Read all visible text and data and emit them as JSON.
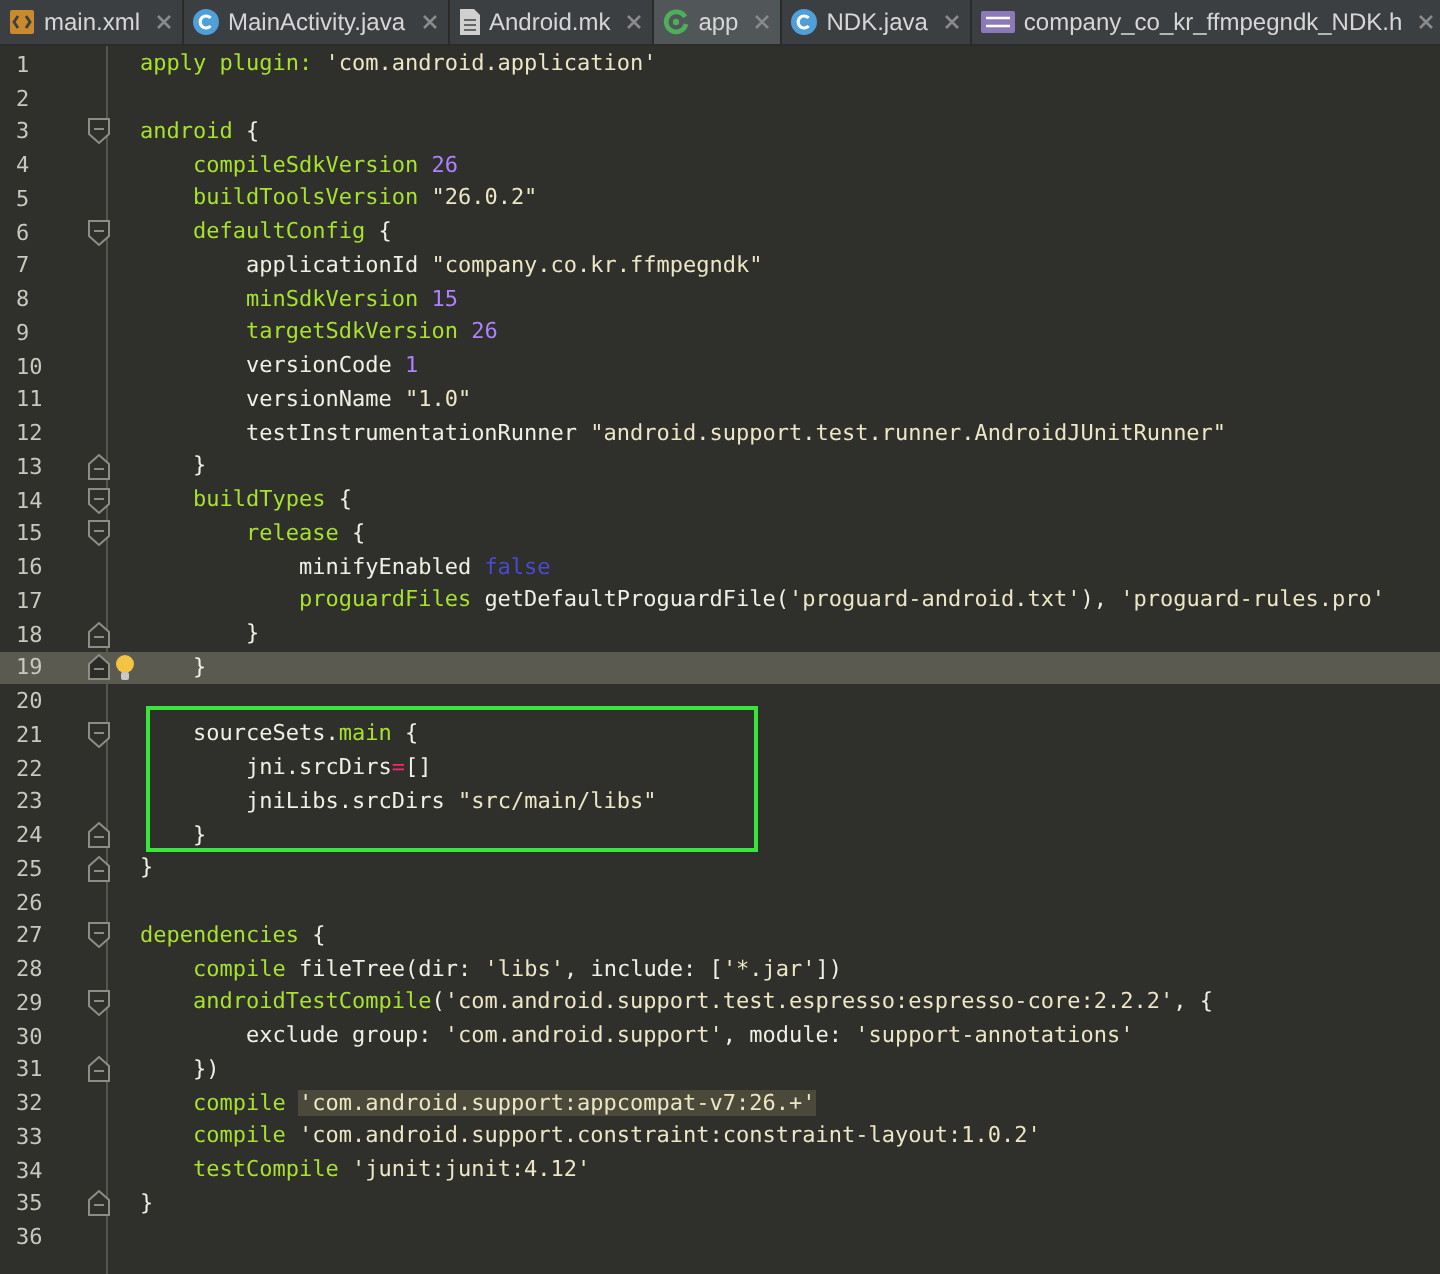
{
  "tabs": [
    {
      "label": "main.xml",
      "kind": "xml",
      "selected": false
    },
    {
      "label": "MainActivity.java",
      "kind": "class",
      "selected": false
    },
    {
      "label": "Android.mk",
      "kind": "text",
      "selected": false
    },
    {
      "label": "app",
      "kind": "gradle",
      "selected": true
    },
    {
      "label": "NDK.java",
      "kind": "class",
      "selected": false
    },
    {
      "label": "company_co_kr_ffmpegndk_NDK.h",
      "kind": "header",
      "selected": false
    }
  ],
  "lines": [
    {
      "n": "1",
      "fold_start": false,
      "fold_end": false,
      "current": false,
      "bulb": false,
      "boxed": false,
      "tokens": [
        {
          "t": "apply plugin: ",
          "kind": "k"
        },
        {
          "t": "'com.android.application'",
          "kind": "s"
        }
      ]
    },
    {
      "n": "2",
      "fold_start": false,
      "fold_end": false,
      "current": false,
      "bulb": false,
      "boxed": false
    },
    {
      "n": "3",
      "fold_start": true,
      "fold_end": false,
      "current": false,
      "bulb": false,
      "boxed": false,
      "tokens": [
        {
          "t": "android",
          "kind": "k"
        },
        {
          "t": " {",
          "kind": "p"
        }
      ]
    },
    {
      "n": "4",
      "fold_start": false,
      "fold_end": false,
      "current": false,
      "bulb": false,
      "boxed": false,
      "tokens": [
        {
          "t": "    compileSdkVersion ",
          "kind": "k"
        },
        {
          "t": "26",
          "kind": "n"
        }
      ]
    },
    {
      "n": "5",
      "fold_start": false,
      "fold_end": false,
      "current": false,
      "bulb": false,
      "boxed": false,
      "tokens": [
        {
          "t": "    buildToolsVersion ",
          "kind": "k"
        },
        {
          "t": "\"26.0.2\"",
          "kind": "s"
        }
      ]
    },
    {
      "n": "6",
      "fold_start": true,
      "fold_end": false,
      "current": false,
      "bulb": false,
      "boxed": false,
      "tokens": [
        {
          "t": "    defaultConfig",
          "kind": "k"
        },
        {
          "t": " {",
          "kind": "p"
        }
      ]
    },
    {
      "n": "7",
      "fold_start": false,
      "fold_end": false,
      "current": false,
      "bulb": false,
      "boxed": false,
      "tokens": [
        {
          "t": "        applicationId ",
          "kind": "p"
        },
        {
          "t": "\"company.co.kr.ffmpegndk\"",
          "kind": "s"
        }
      ]
    },
    {
      "n": "8",
      "fold_start": false,
      "fold_end": false,
      "current": false,
      "bulb": false,
      "boxed": false,
      "tokens": [
        {
          "t": "        minSdkVersion ",
          "kind": "k"
        },
        {
          "t": "15",
          "kind": "n"
        }
      ]
    },
    {
      "n": "9",
      "fold_start": false,
      "fold_end": false,
      "current": false,
      "bulb": false,
      "boxed": false,
      "tokens": [
        {
          "t": "        targetSdkVersion ",
          "kind": "k"
        },
        {
          "t": "26",
          "kind": "n"
        }
      ]
    },
    {
      "n": "10",
      "fold_start": false,
      "fold_end": false,
      "current": false,
      "bulb": false,
      "boxed": false,
      "tokens": [
        {
          "t": "        versionCode ",
          "kind": "p"
        },
        {
          "t": "1",
          "kind": "n"
        }
      ]
    },
    {
      "n": "11",
      "fold_start": false,
      "fold_end": false,
      "current": false,
      "bulb": false,
      "boxed": false,
      "tokens": [
        {
          "t": "        versionName ",
          "kind": "p"
        },
        {
          "t": "\"1.0\"",
          "kind": "s"
        }
      ]
    },
    {
      "n": "12",
      "fold_start": false,
      "fold_end": false,
      "current": false,
      "bulb": false,
      "boxed": false,
      "tokens": [
        {
          "t": "        testInstrumentationRunner ",
          "kind": "p"
        },
        {
          "t": "\"android.support.test.runner.AndroidJUnitRunner\"",
          "kind": "s"
        }
      ]
    },
    {
      "n": "13",
      "fold_start": false,
      "fold_end": true,
      "current": false,
      "bulb": false,
      "boxed": false,
      "tokens": [
        {
          "t": "    }",
          "kind": "p"
        }
      ]
    },
    {
      "n": "14",
      "fold_start": true,
      "fold_end": false,
      "current": false,
      "bulb": false,
      "boxed": false,
      "tokens": [
        {
          "t": "    buildTypes",
          "kind": "k"
        },
        {
          "t": " {",
          "kind": "p"
        }
      ]
    },
    {
      "n": "15",
      "fold_start": true,
      "fold_end": false,
      "current": false,
      "bulb": false,
      "boxed": false,
      "tokens": [
        {
          "t": "        release",
          "kind": "k"
        },
        {
          "t": " {",
          "kind": "p"
        }
      ]
    },
    {
      "n": "16",
      "fold_start": false,
      "fold_end": false,
      "current": false,
      "bulb": false,
      "boxed": false,
      "tokens": [
        {
          "t": "            minifyEnabled ",
          "kind": "p"
        },
        {
          "t": "false",
          "kind": "b"
        }
      ]
    },
    {
      "n": "17",
      "fold_start": false,
      "fold_end": false,
      "current": false,
      "bulb": false,
      "boxed": false,
      "tokens": [
        {
          "t": "            proguardFiles ",
          "kind": "k"
        },
        {
          "t": "getDefaultProguardFile(",
          "kind": "p"
        },
        {
          "t": "'proguard-android.txt'",
          "kind": "s"
        },
        {
          "t": "), ",
          "kind": "p"
        },
        {
          "t": "'proguard-rules.pro'",
          "kind": "s"
        }
      ]
    },
    {
      "n": "18",
      "fold_start": false,
      "fold_end": true,
      "current": false,
      "bulb": false,
      "boxed": false,
      "tokens": [
        {
          "t": "        }",
          "kind": "p"
        }
      ]
    },
    {
      "n": "19",
      "fold_start": false,
      "fold_end": true,
      "current": true,
      "bulb": true,
      "boxed": false,
      "tokens": [
        {
          "t": "    }",
          "kind": "p"
        }
      ]
    },
    {
      "n": "20",
      "fold_start": false,
      "fold_end": false,
      "current": false,
      "bulb": false,
      "boxed": false
    },
    {
      "n": "21",
      "fold_start": true,
      "fold_end": false,
      "current": false,
      "bulb": false,
      "boxed": true,
      "tokens": [
        {
          "t": "    sourceSets.",
          "kind": "p"
        },
        {
          "t": "main",
          "kind": "k"
        },
        {
          "t": " {",
          "kind": "p"
        }
      ]
    },
    {
      "n": "22",
      "fold_start": false,
      "fold_end": false,
      "current": false,
      "bulb": false,
      "boxed": true,
      "tokens": [
        {
          "t": "        jni.srcDirs",
          "kind": "p"
        },
        {
          "t": "=",
          "kind": "o"
        },
        {
          "t": "[]",
          "kind": "p"
        }
      ]
    },
    {
      "n": "23",
      "fold_start": false,
      "fold_end": false,
      "current": false,
      "bulb": false,
      "boxed": true,
      "tokens": [
        {
          "t": "        jniLibs.srcDirs ",
          "kind": "p"
        },
        {
          "t": "\"src/main/libs\"",
          "kind": "s"
        }
      ]
    },
    {
      "n": "24",
      "fold_start": false,
      "fold_end": true,
      "current": false,
      "bulb": false,
      "boxed": true,
      "tokens": [
        {
          "t": "    }",
          "kind": "p"
        }
      ]
    },
    {
      "n": "25",
      "fold_start": false,
      "fold_end": true,
      "current": false,
      "bulb": false,
      "boxed": false,
      "tokens": [
        {
          "t": "}",
          "kind": "p"
        }
      ]
    },
    {
      "n": "26",
      "fold_start": false,
      "fold_end": false,
      "current": false,
      "bulb": false,
      "boxed": false
    },
    {
      "n": "27",
      "fold_start": true,
      "fold_end": false,
      "current": false,
      "bulb": false,
      "boxed": false,
      "tokens": [
        {
          "t": "dependencies",
          "kind": "k"
        },
        {
          "t": " {",
          "kind": "p"
        }
      ]
    },
    {
      "n": "28",
      "fold_start": false,
      "fold_end": false,
      "current": false,
      "bulb": false,
      "boxed": false,
      "tokens": [
        {
          "t": "    compile ",
          "kind": "k"
        },
        {
          "t": "fileTree(dir: ",
          "kind": "p"
        },
        {
          "t": "'libs'",
          "kind": "s"
        },
        {
          "t": ", include: [",
          "kind": "p"
        },
        {
          "t": "'*.jar'",
          "kind": "s"
        },
        {
          "t": "])",
          "kind": "p"
        }
      ]
    },
    {
      "n": "29",
      "fold_start": true,
      "fold_end": false,
      "current": false,
      "bulb": false,
      "boxed": false,
      "tokens": [
        {
          "t": "    androidTestCompile",
          "kind": "k"
        },
        {
          "t": "(",
          "kind": "p"
        },
        {
          "t": "'com.android.support.test.espresso:espresso-core:2.2.2'",
          "kind": "s"
        },
        {
          "t": ", {",
          "kind": "p"
        }
      ]
    },
    {
      "n": "30",
      "fold_start": false,
      "fold_end": false,
      "current": false,
      "bulb": false,
      "boxed": false,
      "tokens": [
        {
          "t": "        exclude group: ",
          "kind": "p"
        },
        {
          "t": "'com.android.support'",
          "kind": "s"
        },
        {
          "t": ", module: ",
          "kind": "p"
        },
        {
          "t": "'support-annotations'",
          "kind": "s"
        }
      ]
    },
    {
      "n": "31",
      "fold_start": false,
      "fold_end": true,
      "current": false,
      "bulb": false,
      "boxed": false,
      "tokens": [
        {
          "t": "    })",
          "kind": "p"
        }
      ]
    },
    {
      "n": "32",
      "fold_start": false,
      "fold_end": false,
      "current": false,
      "bulb": false,
      "boxed": false,
      "tokens": [
        {
          "t": "    compile ",
          "kind": "k"
        },
        {
          "t": "'com.android.support:appcompat-v7:26.+'",
          "kind": "marked"
        }
      ]
    },
    {
      "n": "33",
      "fold_start": false,
      "fold_end": false,
      "current": false,
      "bulb": false,
      "boxed": false,
      "tokens": [
        {
          "t": "    compile ",
          "kind": "k"
        },
        {
          "t": "'com.android.support.constraint:constraint-layout:1.0.2'",
          "kind": "s"
        }
      ]
    },
    {
      "n": "34",
      "fold_start": false,
      "fold_end": false,
      "current": false,
      "bulb": false,
      "boxed": false,
      "tokens": [
        {
          "t": "    testCompile ",
          "kind": "k"
        },
        {
          "t": "'junit:junit:4.12'",
          "kind": "s"
        }
      ]
    },
    {
      "n": "35",
      "fold_start": false,
      "fold_end": true,
      "current": false,
      "bulb": false,
      "boxed": false,
      "tokens": [
        {
          "t": "}",
          "kind": "p"
        }
      ]
    },
    {
      "n": "36",
      "fold_start": false,
      "fold_end": false,
      "current": false,
      "bulb": false,
      "boxed": false
    }
  ]
}
